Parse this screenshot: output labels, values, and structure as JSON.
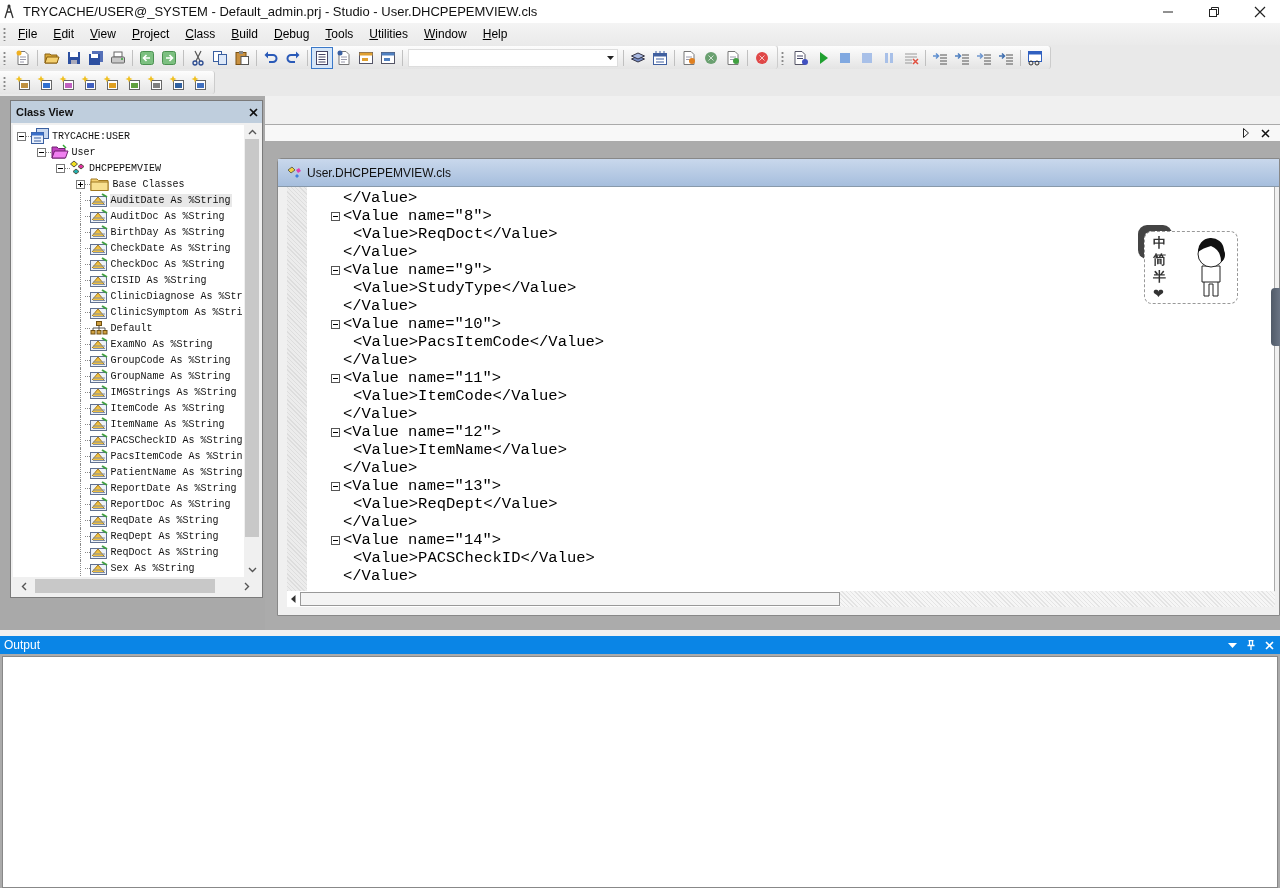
{
  "window": {
    "title": "TRYCACHE/USER@_SYSTEM - Default_admin.prj - Studio - User.DHCPEPEMVIEW.cls"
  },
  "menu": [
    {
      "label": "File"
    },
    {
      "label": "Edit"
    },
    {
      "label": "View"
    },
    {
      "label": "Project"
    },
    {
      "label": "Class"
    },
    {
      "label": "Build"
    },
    {
      "label": "Debug"
    },
    {
      "label": "Tools"
    },
    {
      "label": "Utilities"
    },
    {
      "label": "Window"
    },
    {
      "label": "Help"
    }
  ],
  "class_view": {
    "title": "Class View",
    "tree": [
      {
        "label": "TRYCACHE:USER",
        "kind": "namespace",
        "expanded": true,
        "selected": false,
        "children": [
          {
            "label": "User",
            "kind": "package",
            "expanded": true,
            "selected": false,
            "children": [
              {
                "label": "DHCPEPEMVIEW",
                "kind": "class",
                "expanded": true,
                "selected": false,
                "children": [
                  {
                    "label": "Base Classes",
                    "kind": "folder",
                    "expanded": false,
                    "selected": false
                  },
                  {
                    "label": "AuditDate As %String",
                    "kind": "property",
                    "selected": true
                  },
                  {
                    "label": "AuditDoc As %String",
                    "kind": "property",
                    "selected": false
                  },
                  {
                    "label": "BirthDay As %String",
                    "kind": "property",
                    "selected": false
                  },
                  {
                    "label": "CheckDate As %String",
                    "kind": "property",
                    "selected": false
                  },
                  {
                    "label": "CheckDoc As %String",
                    "kind": "property",
                    "selected": false
                  },
                  {
                    "label": "CISID As %String",
                    "kind": "property",
                    "selected": false
                  },
                  {
                    "label": "ClinicDiagnose As %Str",
                    "kind": "property",
                    "selected": false
                  },
                  {
                    "label": "ClinicSymptom As %Stri",
                    "kind": "property",
                    "selected": false
                  },
                  {
                    "label": "Default",
                    "kind": "index",
                    "selected": false
                  },
                  {
                    "label": "ExamNo As %String",
                    "kind": "property",
                    "selected": false
                  },
                  {
                    "label": "GroupCode As %String",
                    "kind": "property",
                    "selected": false
                  },
                  {
                    "label": "GroupName As %String",
                    "kind": "property",
                    "selected": false
                  },
                  {
                    "label": "IMGStrings As %String",
                    "kind": "property",
                    "selected": false
                  },
                  {
                    "label": "ItemCode As %String",
                    "kind": "property",
                    "selected": false
                  },
                  {
                    "label": "ItemName As %String",
                    "kind": "property",
                    "selected": false
                  },
                  {
                    "label": "PACSCheckID As %String",
                    "kind": "property",
                    "selected": false
                  },
                  {
                    "label": "PacsItemCode As %Strin",
                    "kind": "property",
                    "selected": false
                  },
                  {
                    "label": "PatientName As %String",
                    "kind": "property",
                    "selected": false
                  },
                  {
                    "label": "ReportDate As %String",
                    "kind": "property",
                    "selected": false
                  },
                  {
                    "label": "ReportDoc As %String",
                    "kind": "property",
                    "selected": false
                  },
                  {
                    "label": "ReqDate As %String",
                    "kind": "property",
                    "selected": false
                  },
                  {
                    "label": "ReqDept As %String",
                    "kind": "property",
                    "selected": false
                  },
                  {
                    "label": "ReqDoct As %String",
                    "kind": "property",
                    "selected": false
                  },
                  {
                    "label": "Sex As %String",
                    "kind": "property",
                    "selected": false
                  }
                ]
              }
            ]
          }
        ]
      }
    ]
  },
  "editor": {
    "title": "User.DHCPEPEMVIEW.cls",
    "lines": [
      {
        "kind": "close",
        "text": "</Value>"
      },
      {
        "kind": "open",
        "text": "<Value name=\"8\">"
      },
      {
        "kind": "value",
        "text": "<Value>ReqDoct</Value>"
      },
      {
        "kind": "close",
        "text": "</Value>"
      },
      {
        "kind": "open",
        "text": "<Value name=\"9\">"
      },
      {
        "kind": "value",
        "text": "<Value>StudyType</Value>"
      },
      {
        "kind": "close",
        "text": "</Value>"
      },
      {
        "kind": "open",
        "text": "<Value name=\"10\">"
      },
      {
        "kind": "value",
        "text": "<Value>PacsItemCode</Value>"
      },
      {
        "kind": "close",
        "text": "</Value>"
      },
      {
        "kind": "open",
        "text": "<Value name=\"11\">"
      },
      {
        "kind": "value",
        "text": "<Value>ItemCode</Value>"
      },
      {
        "kind": "close",
        "text": "</Value>"
      },
      {
        "kind": "open",
        "text": "<Value name=\"12\">"
      },
      {
        "kind": "value",
        "text": "<Value>ItemName</Value>"
      },
      {
        "kind": "close",
        "text": "</Value>"
      },
      {
        "kind": "open",
        "text": "<Value name=\"13\">"
      },
      {
        "kind": "value",
        "text": "<Value>ReqDept</Value>"
      },
      {
        "kind": "close",
        "text": "</Value>"
      },
      {
        "kind": "open",
        "text": "<Value name=\"14\">"
      },
      {
        "kind": "value",
        "text": "<Value>PACSCheckID</Value>"
      },
      {
        "kind": "close",
        "text": "</Value>"
      }
    ]
  },
  "ime_widget": {
    "chars": [
      "中",
      "简",
      "半",
      "❤"
    ]
  },
  "output": {
    "title": "Output"
  }
}
